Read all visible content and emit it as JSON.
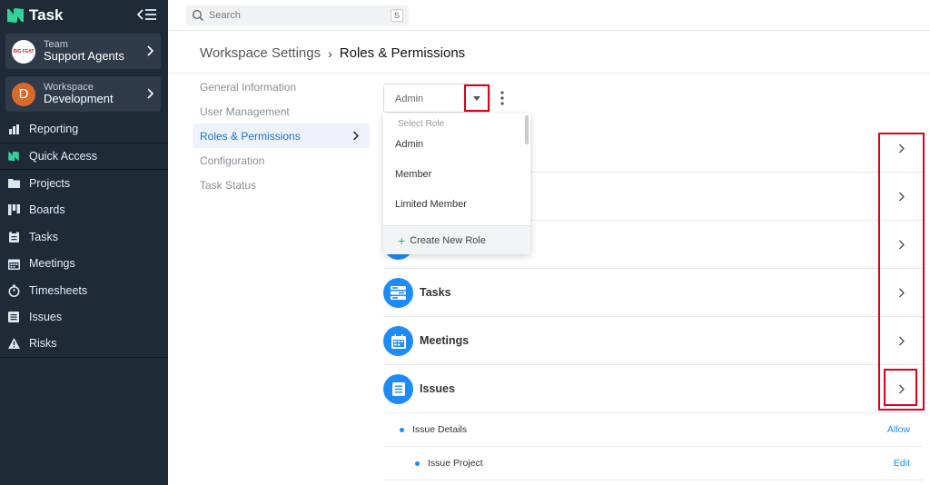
{
  "app": {
    "name": "Task"
  },
  "sidebar": {
    "team": {
      "sub": "Team",
      "main": "Support Agents",
      "badge": "BIG FEAT"
    },
    "workspace": {
      "sub": "Workspace",
      "main": "Development",
      "initial": "D"
    },
    "items": [
      {
        "label": "Reporting",
        "icon": "reporting-icon"
      },
      {
        "label": "Quick Access",
        "icon": "quick-access-icon"
      },
      {
        "label": "Projects",
        "icon": "folder-icon"
      },
      {
        "label": "Boards",
        "icon": "boards-icon"
      },
      {
        "label": "Tasks",
        "icon": "clipboard-icon"
      },
      {
        "label": "Meetings",
        "icon": "calendar-icon"
      },
      {
        "label": "Timesheets",
        "icon": "stopwatch-icon"
      },
      {
        "label": "Issues",
        "icon": "list-icon"
      },
      {
        "label": "Risks",
        "icon": "warning-icon"
      }
    ]
  },
  "search": {
    "placeholder": "Search",
    "shortcut": "S"
  },
  "breadcrumb": {
    "parent": "Workspace Settings",
    "current": "Roles & Permissions"
  },
  "settings_menu": [
    "General Information",
    "User Management",
    "Roles & Permissions",
    "Configuration",
    "Task Status"
  ],
  "role_select": {
    "value": "Admin",
    "header": "Select Role",
    "options": [
      "Admin",
      "Member",
      "Limited Member"
    ],
    "create": "Create New Role"
  },
  "permission_rows": [
    "Tasks",
    "Meetings",
    "Issues"
  ],
  "sub_permissions": [
    {
      "label": "Issue Details",
      "action": "Allow"
    },
    {
      "label": "Issue Project",
      "action": "Edit"
    }
  ],
  "colors": {
    "accent": "#1d8cf8",
    "sidebar": "#1e2a36",
    "highlight": "#e0001b"
  }
}
